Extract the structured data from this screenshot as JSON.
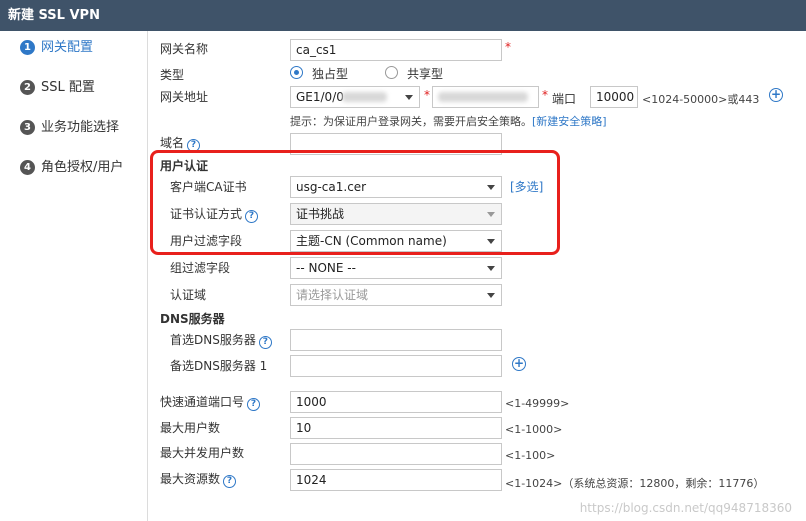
{
  "window": {
    "title": "新建 SSL VPN"
  },
  "sidebar": {
    "steps": [
      {
        "num": "1",
        "label": "网关配置",
        "active": true
      },
      {
        "num": "2",
        "label": "SSL 配置"
      },
      {
        "num": "3",
        "label": "业务功能选择"
      },
      {
        "num": "4",
        "label": "角色授权/用户"
      }
    ]
  },
  "form": {
    "gateway_name": {
      "label": "网关名称",
      "value": "ca_cs1"
    },
    "type": {
      "label": "类型",
      "options": [
        "独占型",
        "共享型"
      ],
      "selected": "独占型"
    },
    "gateway_address": {
      "label": "网关地址",
      "interface_value": "GE1/0/0",
      "port_label": "端口",
      "port_value": "10000",
      "port_hint": "<1024-50000>或443"
    },
    "tip": {
      "text": "提示：为保证用户登录网关，需要开启安全策略。",
      "link": "[新建安全策略]"
    },
    "domain": {
      "label": "域名",
      "value": ""
    },
    "user_auth": {
      "title": "用户认证",
      "client_ca": {
        "label": "客户端CA证书",
        "value": "usg-ca1.cer",
        "link": "[多选]"
      },
      "cert_auth_method": {
        "label": "证书认证方式",
        "value": "证书挑战"
      },
      "user_filter": {
        "label": "用户过滤字段",
        "value": "主题-CN (Common name)"
      },
      "group_filter": {
        "label": "组过滤字段",
        "value": "-- NONE --"
      },
      "auth_domain": {
        "label": "认证域",
        "placeholder": "请选择认证域"
      }
    },
    "dns": {
      "title": "DNS服务器",
      "primary": {
        "label": "首选DNS服务器",
        "value": ""
      },
      "secondary": {
        "label": "备选DNS服务器 1",
        "value": ""
      }
    },
    "fast_port": {
      "label": "快速通道端口号",
      "value": "1000",
      "hint": "<1-49999>"
    },
    "max_users": {
      "label": "最大用户数",
      "value": "10",
      "hint": "<1-1000>"
    },
    "max_concurrent": {
      "label": "最大并发用户数",
      "value": "",
      "hint": "<1-100>"
    },
    "max_resources": {
      "label": "最大资源数",
      "value": "1024",
      "hint": "<1-1024>（系统总资源：12800，剩余：11776）"
    }
  },
  "watermark": "https://blog.csdn.net/qq948718360"
}
